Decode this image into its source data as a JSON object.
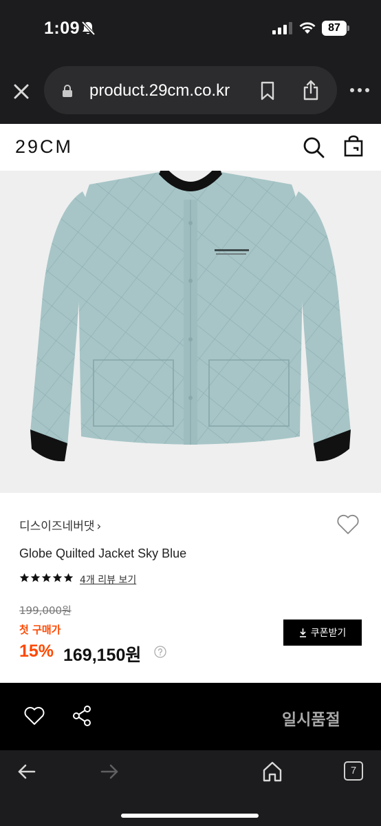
{
  "status_bar": {
    "time": "1:09",
    "battery": "87"
  },
  "browser": {
    "url": "product.29cm.co.kr",
    "tab_count": "7"
  },
  "site": {
    "logo": "29CM"
  },
  "product": {
    "brand": "디스이즈네버댓",
    "brand_chevron": "›",
    "name": "Globe Quilted Jacket Sky Blue",
    "rating_stars": 5,
    "review_link": "4개 리뷰 보기",
    "original_price": "199,000원",
    "first_purchase_label": "첫 구매가",
    "discount": "15%",
    "sale_price": "169,150원",
    "image_color": "#a9c7c9"
  },
  "actions": {
    "coupon_label": "쿠폰받기",
    "soldout_label": "일시품절"
  },
  "colors": {
    "accent": "#ff4800",
    "browser_chrome": "#1c1c1e"
  }
}
